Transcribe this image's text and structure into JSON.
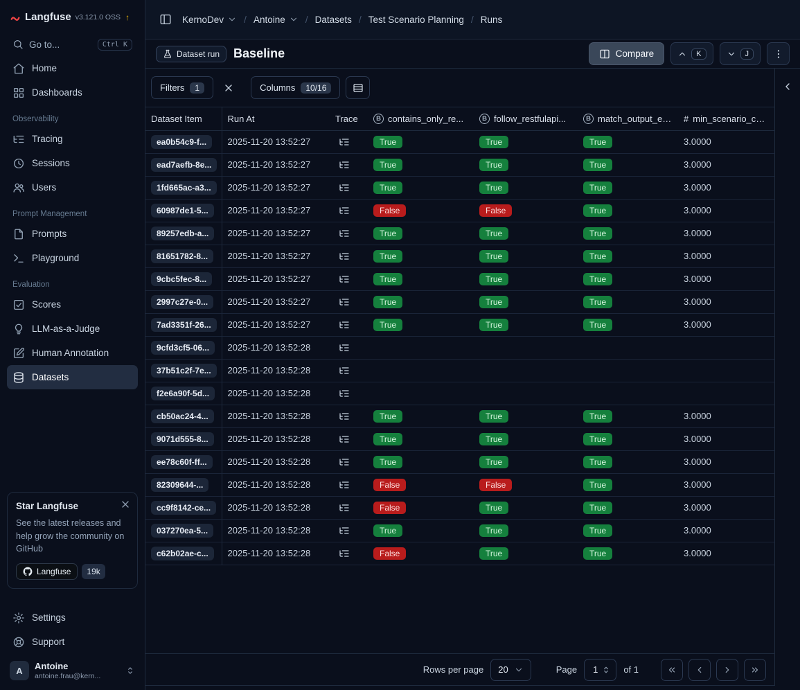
{
  "colors": {
    "true_bg": "#15803d",
    "true_fg": "#d7f7e0",
    "false_bg": "#b91c1c",
    "false_fg": "#fbdcdc"
  },
  "sidebar": {
    "brand": "Langfuse",
    "version": "v3.121.0 OSS",
    "upgrade_icon": "↑",
    "goto_label": "Go to...",
    "goto_shortcut": "Ctrl K",
    "section_titles": {
      "observability": "Observability",
      "prompt_management": "Prompt Management",
      "evaluation": "Evaluation"
    },
    "items": {
      "home": "Home",
      "dashboards": "Dashboards",
      "tracing": "Tracing",
      "sessions": "Sessions",
      "users": "Users",
      "prompts": "Prompts",
      "playground": "Playground",
      "scores": "Scores",
      "llm_judge": "LLM-as-a-Judge",
      "human_annotation": "Human Annotation",
      "datasets": "Datasets",
      "settings": "Settings",
      "support": "Support"
    },
    "star_card": {
      "title": "Star Langfuse",
      "body": "See the latest releases and help grow the community on GitHub",
      "github_label": "Langfuse",
      "stars": "19k"
    },
    "user": {
      "initial": "A",
      "name": "Antoine",
      "email": "antoine.frau@kern..."
    }
  },
  "breadcrumb": {
    "org": "KernoDev",
    "project": "Antoine",
    "section": "Datasets",
    "dataset": "Test Scenario Planning",
    "page": "Runs"
  },
  "header": {
    "badge": "Dataset run",
    "title": "Baseline",
    "compare": "Compare",
    "key_up": "K",
    "key_down": "J"
  },
  "toolbar": {
    "filters": "Filters",
    "filters_count": "1",
    "columns": "Columns",
    "columns_count": "10/16"
  },
  "table": {
    "headers": {
      "dataset_item": "Dataset Item",
      "run_at": "Run At",
      "trace": "Trace",
      "bool_glyph": "B",
      "score1": "contains_only_re...",
      "score2": "follow_restfulapi...",
      "score3": "match_output_ex...",
      "num_prefix": "#",
      "num": "min_scenario_cou..."
    },
    "rows": [
      {
        "id": "ea0b54c9-f...",
        "run_at": "2025-11-20 13:52:27",
        "s1": "True",
        "s2": "True",
        "s3": "True",
        "num": "3.0000"
      },
      {
        "id": "ead7aefb-8e...",
        "run_at": "2025-11-20 13:52:27",
        "s1": "True",
        "s2": "True",
        "s3": "True",
        "num": "3.0000"
      },
      {
        "id": "1fd665ac-a3...",
        "run_at": "2025-11-20 13:52:27",
        "s1": "True",
        "s2": "True",
        "s3": "True",
        "num": "3.0000"
      },
      {
        "id": "60987de1-5...",
        "run_at": "2025-11-20 13:52:27",
        "s1": "False",
        "s2": "False",
        "s3": "True",
        "num": "3.0000"
      },
      {
        "id": "89257edb-a...",
        "run_at": "2025-11-20 13:52:27",
        "s1": "True",
        "s2": "True",
        "s3": "True",
        "num": "3.0000"
      },
      {
        "id": "81651782-8...",
        "run_at": "2025-11-20 13:52:27",
        "s1": "True",
        "s2": "True",
        "s3": "True",
        "num": "3.0000"
      },
      {
        "id": "9cbc5fec-8...",
        "run_at": "2025-11-20 13:52:27",
        "s1": "True",
        "s2": "True",
        "s3": "True",
        "num": "3.0000"
      },
      {
        "id": "2997c27e-0...",
        "run_at": "2025-11-20 13:52:27",
        "s1": "True",
        "s2": "True",
        "s3": "True",
        "num": "3.0000"
      },
      {
        "id": "7ad3351f-26...",
        "run_at": "2025-11-20 13:52:27",
        "s1": "True",
        "s2": "True",
        "s3": "True",
        "num": "3.0000"
      },
      {
        "id": "9cfd3cf5-06...",
        "run_at": "2025-11-20 13:52:28",
        "s1": "",
        "s2": "",
        "s3": "",
        "num": ""
      },
      {
        "id": "37b51c2f-7e...",
        "run_at": "2025-11-20 13:52:28",
        "s1": "",
        "s2": "",
        "s3": "",
        "num": ""
      },
      {
        "id": "f2e6a90f-5d...",
        "run_at": "2025-11-20 13:52:28",
        "s1": "",
        "s2": "",
        "s3": "",
        "num": ""
      },
      {
        "id": "cb50ac24-4...",
        "run_at": "2025-11-20 13:52:28",
        "s1": "True",
        "s2": "True",
        "s3": "True",
        "num": "3.0000"
      },
      {
        "id": "9071d555-8...",
        "run_at": "2025-11-20 13:52:28",
        "s1": "True",
        "s2": "True",
        "s3": "True",
        "num": "3.0000"
      },
      {
        "id": "ee78c60f-ff...",
        "run_at": "2025-11-20 13:52:28",
        "s1": "True",
        "s2": "True",
        "s3": "True",
        "num": "3.0000"
      },
      {
        "id": "82309644-...",
        "run_at": "2025-11-20 13:52:28",
        "s1": "False",
        "s2": "False",
        "s3": "True",
        "num": "3.0000"
      },
      {
        "id": "cc9f8142-ce...",
        "run_at": "2025-11-20 13:52:28",
        "s1": "False",
        "s2": "True",
        "s3": "True",
        "num": "3.0000"
      },
      {
        "id": "037270ea-5...",
        "run_at": "2025-11-20 13:52:28",
        "s1": "True",
        "s2": "True",
        "s3": "True",
        "num": "3.0000"
      },
      {
        "id": "c62b02ae-c...",
        "run_at": "2025-11-20 13:52:28",
        "s1": "False",
        "s2": "True",
        "s3": "True",
        "num": "3.0000"
      }
    ]
  },
  "footer": {
    "rows_per_page": "Rows per page",
    "page_size": "20",
    "page_label": "Page",
    "page_value": "1",
    "of_label": "of 1"
  }
}
